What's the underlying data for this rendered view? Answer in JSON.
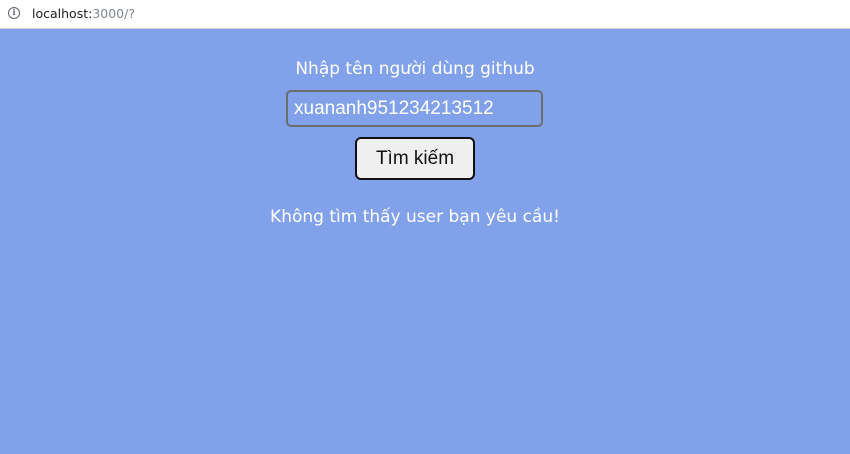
{
  "browser": {
    "url_host": "localhost:",
    "url_path": "3000/?",
    "info_icon": "info-icon"
  },
  "form": {
    "label": "Nhập tên người dùng github",
    "input_value": "xuananh951234213512",
    "button_label": "Tìm kiếm"
  },
  "result": {
    "message": "Không tìm thấy user bạn yêu cầu!"
  },
  "colors": {
    "page_background": "#81a2ea",
    "text": "#ffffff",
    "button_background": "#efefef"
  }
}
